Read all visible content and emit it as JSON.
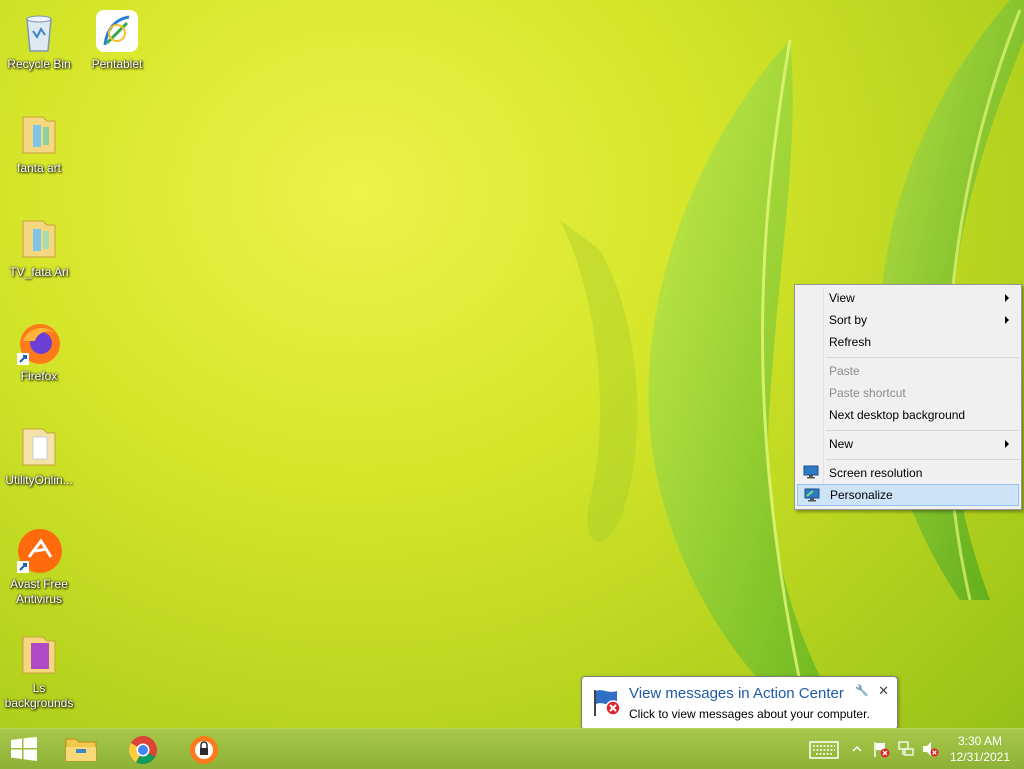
{
  "desktop": {
    "icons": [
      {
        "label": "Recycle Bin"
      },
      {
        "label": "Pentablet"
      },
      {
        "label": "fanta art"
      },
      {
        "label": "TV_fata Ari"
      },
      {
        "label": "Firefox"
      },
      {
        "label": "UtilityOnlin..."
      },
      {
        "label": "Avast Free Antivirus"
      },
      {
        "label": "Ls backgrounds"
      }
    ]
  },
  "context_menu": {
    "items": [
      {
        "label": "View",
        "submenu": true,
        "enabled": true
      },
      {
        "label": "Sort by",
        "submenu": true,
        "enabled": true
      },
      {
        "label": "Refresh",
        "enabled": true
      },
      {
        "label": "Paste",
        "enabled": false
      },
      {
        "label": "Paste shortcut",
        "enabled": false
      },
      {
        "label": "Next desktop background",
        "enabled": true
      },
      {
        "label": "New",
        "submenu": true,
        "enabled": true
      },
      {
        "label": "Screen resolution",
        "enabled": true,
        "icon": "monitor-icon"
      },
      {
        "label": "Personalize",
        "enabled": true,
        "icon": "personalize-monitor-icon",
        "highlighted": true
      }
    ]
  },
  "notification": {
    "title": "View messages in Action Center",
    "text": "Click to view messages about your computer."
  },
  "taskbar": {
    "pinned": [
      {
        "icon": "windows-start-icon"
      },
      {
        "icon": "file-explorer-icon"
      },
      {
        "icon": "chrome-icon"
      },
      {
        "icon": "avast-secure-browser-icon"
      }
    ],
    "tray": [
      "touch-keyboard-icon",
      "show-hidden-icons-chevron",
      "action-center-flag-icon",
      "network-icon",
      "volume-muted-icon"
    ],
    "clock": {
      "time": "3:30 AM",
      "date": "12/31/2021"
    }
  },
  "colors": {
    "accent": "#1e5aa8",
    "taskbar": "#9cbd3f",
    "highlight": "#cde3f7"
  }
}
